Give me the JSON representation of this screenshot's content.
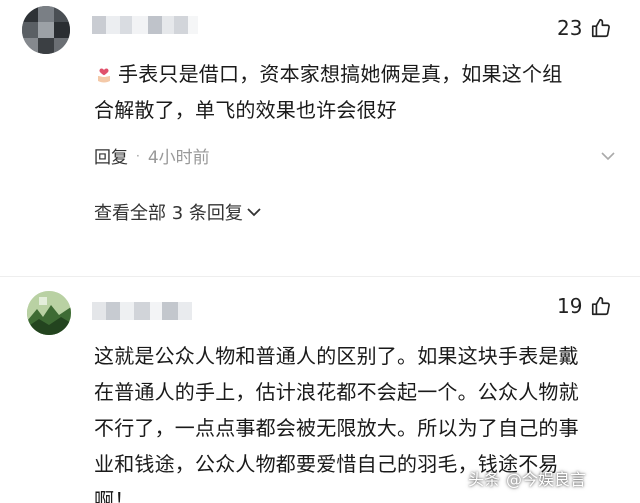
{
  "comments": [
    {
      "likes": "23",
      "lines": [
        "手表只是借口，资本家想搞她俩是真，如果这个组",
        "合解散了，单飞的效果也许会很好"
      ],
      "reply_label": "回复",
      "separator": "·",
      "time": "4小时前",
      "view_all": "查看全部 3 条回复"
    },
    {
      "likes": "19",
      "lines": [
        "这就是公众人物和普通人的区别了。如果这块手表是戴",
        "在普通人的手上，估计浪花都不会起一个。公众人物就",
        "不行了，一点点事都会被无限放大。所以为了自己的事",
        "业和钱途，公众人物都要爱惜自己的羽毛，钱途不易",
        "啊！"
      ]
    }
  ],
  "watermark": {
    "brand": "头条",
    "handle": "@今娱良言"
  },
  "icons": {
    "like": "thumbs-up-icon",
    "emoji": "heart-hand-emoji",
    "more": "chevron-down-icon"
  }
}
